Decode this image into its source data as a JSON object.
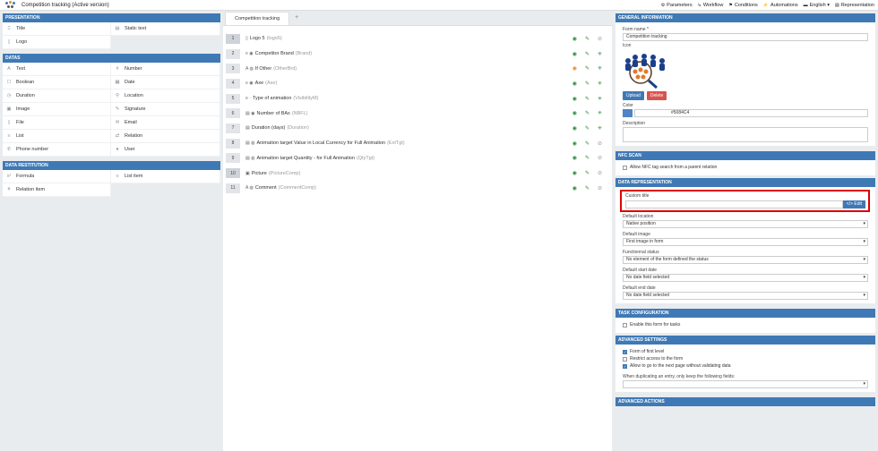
{
  "app": {
    "title": "Competition tracking (Active version)"
  },
  "topnav": [
    {
      "icon": "gear-icon",
      "glyph": "⚙",
      "label": "Parameters"
    },
    {
      "icon": "workflow-icon",
      "glyph": "↳",
      "label": "Workflow"
    },
    {
      "icon": "flag-icon",
      "glyph": "⚑",
      "label": "Conditions"
    },
    {
      "icon": "automation-icon",
      "glyph": "⚡",
      "label": "Automations"
    },
    {
      "icon": "language-icon",
      "glyph": "▬",
      "label": "English ▾"
    },
    {
      "icon": "representation-icon",
      "glyph": "▤",
      "label": "Representation"
    }
  ],
  "left": {
    "presentation": {
      "header": "PRESENTATION",
      "items": [
        {
          "glyph": "⌶",
          "icon": "title-icon",
          "label": "Title"
        },
        {
          "glyph": "▤",
          "icon": "static-text-icon",
          "label": "Static text"
        },
        {
          "glyph": "▯",
          "icon": "logo-icon",
          "label": "Logo"
        }
      ]
    },
    "datas": {
      "header": "DATAS",
      "items": [
        {
          "glyph": "A",
          "icon": "text-icon",
          "label": "Text"
        },
        {
          "glyph": "#",
          "icon": "number-icon",
          "label": "Number"
        },
        {
          "glyph": "☐",
          "icon": "boolean-icon",
          "label": "Boolean"
        },
        {
          "glyph": "▦",
          "icon": "date-icon",
          "label": "Date"
        },
        {
          "glyph": "◷",
          "icon": "duration-icon",
          "label": "Duration"
        },
        {
          "glyph": "⚲",
          "icon": "location-icon",
          "label": "Location"
        },
        {
          "glyph": "▣",
          "icon": "image-icon",
          "label": "Image"
        },
        {
          "glyph": "✎",
          "icon": "signature-icon",
          "label": "Signature"
        },
        {
          "glyph": "▯",
          "icon": "file-icon",
          "label": "File"
        },
        {
          "glyph": "✉",
          "icon": "email-icon",
          "label": "Email"
        },
        {
          "glyph": "≡",
          "icon": "list-icon",
          "label": "List"
        },
        {
          "glyph": "⇄",
          "icon": "relation-icon",
          "label": "Relation"
        },
        {
          "glyph": "✆",
          "icon": "phone-icon",
          "label": "Phone number"
        },
        {
          "glyph": "●",
          "icon": "user-icon",
          "label": "User"
        }
      ]
    },
    "restitution": {
      "header": "DATA RESTITUTION",
      "items": [
        {
          "glyph": "x²",
          "icon": "formula-icon",
          "label": "Formula"
        },
        {
          "glyph": "≡",
          "icon": "list-item-icon",
          "label": "List item"
        },
        {
          "glyph": "⚘",
          "icon": "relation-item-icon",
          "label": "Relation item"
        }
      ]
    }
  },
  "center": {
    "tab": "Competition tracking",
    "add_tab": "+",
    "rows": [
      {
        "num": "1",
        "icon": "logo-icon",
        "glyph": "▯",
        "label": "Logo 5",
        "sub": "(logo5)",
        "eye": "green",
        "star": false
      },
      {
        "num": "2",
        "icon": "list-icon",
        "glyph": "≡ ◉",
        "label": "Competitor Brand",
        "sub": "(Brand)",
        "eye": "green",
        "star": true
      },
      {
        "num": "3",
        "icon": "text-icon",
        "glyph": "A ◍",
        "label": "If Other",
        "sub": "(OtherBrd)",
        "eye": "orange",
        "star": true
      },
      {
        "num": "4",
        "icon": "list-icon",
        "glyph": "≡ ◉",
        "label": "Axe",
        "sub": "(Axe)",
        "eye": "green",
        "star": true
      },
      {
        "num": "5",
        "icon": "list-icon",
        "glyph": "≡ ·",
        "label": "Type of animation",
        "sub": "(VisibilityM)",
        "eye": "green",
        "star": true
      },
      {
        "num": "6",
        "icon": "number-icon",
        "glyph": "▤ ◉",
        "label": "Number of BAs",
        "sub": "(NBFL)",
        "eye": "green",
        "star": true
      },
      {
        "num": "7",
        "icon": "duration-icon",
        "glyph": "▤",
        "label": "Duration (days)",
        "sub": "(Duration)",
        "eye": "green",
        "star": true
      },
      {
        "num": "8",
        "icon": "number-icon",
        "glyph": "▤ ◍",
        "label": "Animation target Value in Local Currency for Full Animation",
        "sub": "(ExtTgt)",
        "eye": "green",
        "star": false
      },
      {
        "num": "9",
        "icon": "number-icon",
        "glyph": "▤ ◍",
        "label": "Animation target Quantity - for Full Animation",
        "sub": "(QtyTgt)",
        "eye": "green",
        "star": false
      },
      {
        "num": "10",
        "icon": "image-icon",
        "glyph": "▣",
        "label": "Picture",
        "sub": "(PictureComp)",
        "eye": "green",
        "star": false
      },
      {
        "num": "11",
        "icon": "text-icon",
        "glyph": "A ◍",
        "label": "Comment",
        "sub": "(CommentComp)",
        "eye": "green",
        "star": false
      }
    ]
  },
  "right": {
    "general": {
      "header": "GENERAL INFORMATION",
      "form_name_label": "Form name",
      "form_name_required": "*",
      "form_name_value": "Competition tracking",
      "icon_label": "Icon",
      "upload": "Upload",
      "delete": "Delete",
      "color_label": "Color",
      "color_value": "#5084C4",
      "description_label": "Description"
    },
    "nfc": {
      "header": "NFC SCAN",
      "checkbox": "Allow NFC tag search from a parent relation",
      "checked": false
    },
    "representation": {
      "header": "DATA REPRESENTATION",
      "custom_title_label": "Custom title",
      "edit": "</> Edit",
      "location_label": "Default location",
      "location_value": "Native position",
      "image_label": "Default image",
      "image_value": "First image in form",
      "status_label": "Functionnal status",
      "status_value": "No element of the form defined the status",
      "start_label": "Default start date",
      "start_value": "No date field selected",
      "end_label": "Default end date",
      "end_value": "No date field selected"
    },
    "task": {
      "header": "TASK CONFIGURATION",
      "checkbox": "Enable this form for tasks",
      "checked": false
    },
    "advanced": {
      "header": "ADVANCED SETTINGS",
      "opt1": "Form of first level",
      "opt2": "Restrict access to the form",
      "opt3": "Allow to go to the next page without validating data",
      "dup_label": "When duplicating an entry, only keep the following fields:"
    },
    "actions": {
      "header": "ADVANCED ACTIONS"
    }
  },
  "colors": {
    "accent": "#3f79b5",
    "brand_color": "#5084C4",
    "highlight": "#dd0000"
  }
}
